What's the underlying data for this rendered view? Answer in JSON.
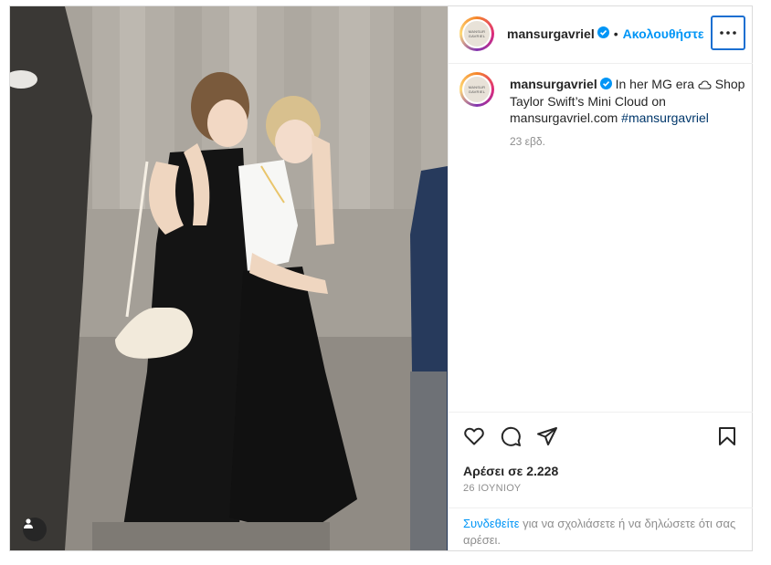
{
  "post": {
    "username": "mansurgavriel",
    "follow_label": "Ακολουθήστε",
    "separator": "•",
    "avatar_text": "MANSUR GAVRIEL",
    "caption": {
      "text_line": "In her MG era",
      "text_rest": "Shop Taylor Swift’s Mini Cloud on mansurgavriel.com",
      "hashtag": "#mansurgavriel",
      "time_ago": "23 εβδ."
    },
    "likes_label": "Αρέσει σε 2.228",
    "date": "26 ΙΟΥΝΙΟΥ",
    "login": {
      "link_text": "Συνδεθείτε",
      "rest_text": "για να σχολιάσετε ή να δηλώσετε ότι σας αρέσει."
    }
  },
  "icons": {
    "verified": "verified-badge-icon",
    "more": "more-options-icon",
    "like": "heart-icon",
    "comment": "comment-icon",
    "share": "paper-plane-icon",
    "save": "bookmark-icon",
    "tag": "user-tag-icon",
    "cloud": "cloud-icon"
  },
  "colors": {
    "accent": "#0095f6",
    "verified": "#0095f6",
    "text": "#262626",
    "muted": "#8e8e8e",
    "hashtag": "#00376b",
    "focus_border": "#1b6fd1"
  }
}
